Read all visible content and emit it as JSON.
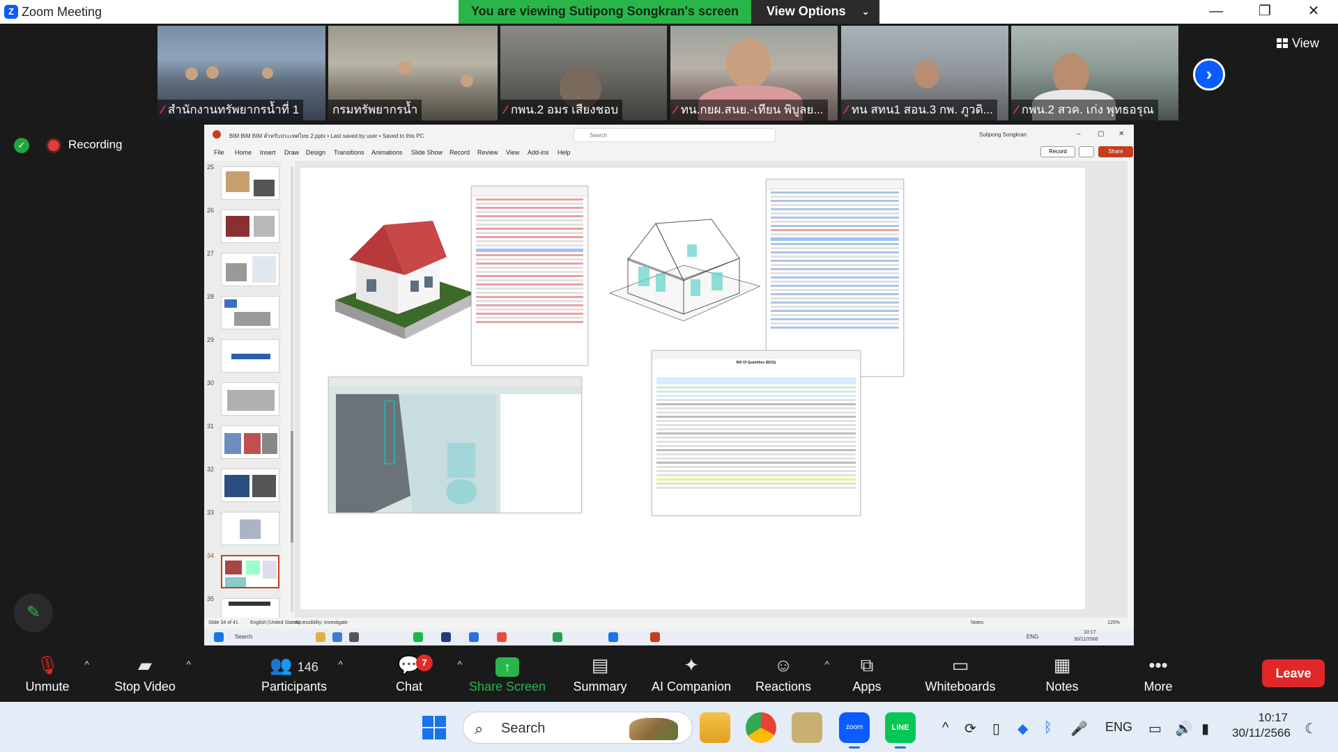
{
  "window": {
    "title": "Zoom Meeting"
  },
  "banner": {
    "text": "You are viewing Sutipong Songkran's screen",
    "view_options": "View Options"
  },
  "view_button": {
    "label": "View"
  },
  "participants_strip": [
    {
      "name": "สำนักงานทรัพยากรน้ำที่ 1"
    },
    {
      "name": "กรมทรัพยากรน้ำ"
    },
    {
      "name": "กพน.2 อมร เสียงชอบ"
    },
    {
      "name": "ทน.กยผ.สนย.-เทียน พิบูลย..."
    },
    {
      "name": "ทน สทน1 สอน.3 กพ. ภูวดิ..."
    },
    {
      "name": "กพน.2 สวค. เก่ง พุทธอรุณ"
    }
  ],
  "recording": {
    "label": "Recording"
  },
  "powerpoint": {
    "title": "BIM BIM BIM สำหรับประเทศไทย 2.pptx  •  Last saved by user  •  Saved to this PC",
    "search_placeholder": "Search",
    "user": "Sutipong Songkran",
    "menu": [
      "File",
      "Home",
      "Insert",
      "Draw",
      "Design",
      "Transitions",
      "Animations",
      "Slide Show",
      "Record",
      "Review",
      "View",
      "Add-ins",
      "Help"
    ],
    "record_btn": "Record",
    "share_btn": "Share",
    "slides": [
      "25",
      "26",
      "27",
      "28",
      "29",
      "30",
      "31",
      "32",
      "33",
      "34",
      "35"
    ],
    "selected_slide": "34",
    "status_left": "Slide 34 of 41",
    "status_lang": "English (United States)",
    "status_access": "Accessibility: Investigate",
    "status_notes": "Notes",
    "zoom_level": "125%",
    "boq_title": "Bill Of Quantities (BOQ)",
    "inner_taskbar_search": "Search",
    "inner_taskbar_lang": "ENG",
    "inner_time": "10:17",
    "inner_date": "30/11/2566"
  },
  "toolbar": {
    "unmute": "Unmute",
    "stop_video": "Stop Video",
    "participants": "Participants",
    "participants_count": "146",
    "chat": "Chat",
    "chat_badge": "7",
    "share_screen": "Share Screen",
    "summary": "Summary",
    "ai_companion": "AI Companion",
    "reactions": "Reactions",
    "apps": "Apps",
    "whiteboards": "Whiteboards",
    "notes": "Notes",
    "more": "More",
    "leave": "Leave"
  },
  "taskbar": {
    "search": "Search",
    "language": "ENG",
    "time": "10:17",
    "date": "30/11/2566"
  },
  "colors": {
    "zoom_blue": "#0b5cff",
    "banner_green": "#2ab54b",
    "leave_red": "#e02828",
    "ppt_orange": "#c43e1c"
  }
}
